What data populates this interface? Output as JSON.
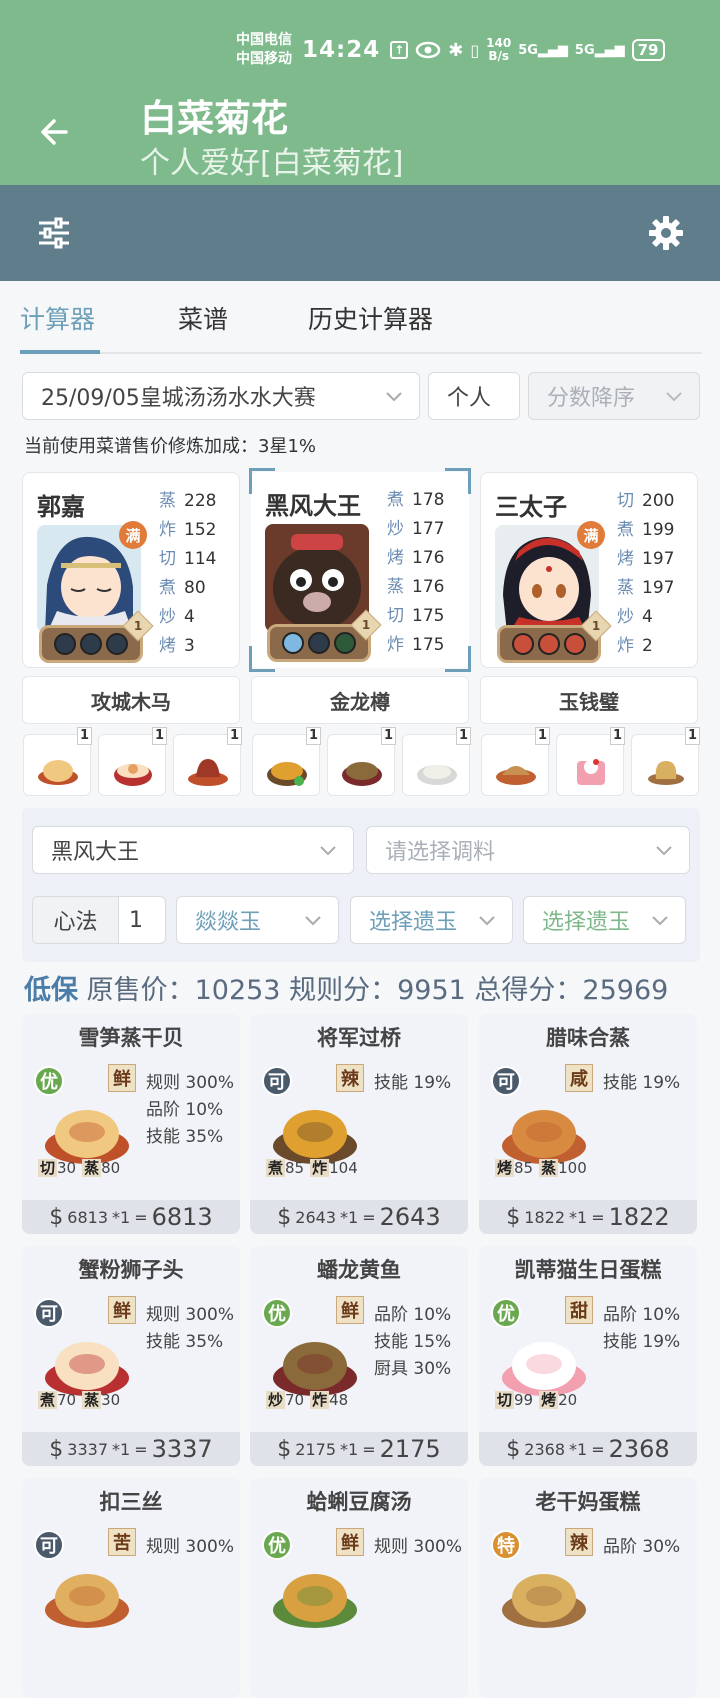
{
  "status": {
    "carrier1": "中国电信",
    "carrier2": "中国移动",
    "time": "14:24",
    "speed_top": "140",
    "speed_bot": "B/s",
    "sig1": "5G",
    "sig2": "5G",
    "battery": "79"
  },
  "header": {
    "title": "白菜菊花",
    "subtitle": "个人爱好[白菜菊花]"
  },
  "tabs": [
    "计算器",
    "菜谱",
    "历史计算器"
  ],
  "filters": {
    "contest": "25/09/05皇城汤汤水水大赛",
    "mode": "个人",
    "sort": "分数降序"
  },
  "note": "当前使用菜谱售价修炼加成：3星1%",
  "chefs": [
    {
      "name": "郭嘉",
      "badge": "满",
      "level": "1",
      "skills": [
        [
          "蒸",
          "228"
        ],
        [
          "炸",
          "152"
        ],
        [
          "切",
          "114"
        ],
        [
          "煮",
          "80"
        ],
        [
          "炒",
          "4"
        ],
        [
          "烤",
          "3"
        ]
      ]
    },
    {
      "name": "黑风大王",
      "level": "1",
      "skills": [
        [
          "煮",
          "178"
        ],
        [
          "炒",
          "177"
        ],
        [
          "烤",
          "176"
        ],
        [
          "蒸",
          "176"
        ],
        [
          "切",
          "175"
        ],
        [
          "炸",
          "175"
        ]
      ]
    },
    {
      "name": "三太子",
      "badge": "满",
      "level": "1",
      "skills": [
        [
          "切",
          "200"
        ],
        [
          "煮",
          "199"
        ],
        [
          "烤",
          "197"
        ],
        [
          "蒸",
          "197"
        ],
        [
          "炒",
          "4"
        ],
        [
          "炸",
          "2"
        ]
      ]
    }
  ],
  "equips": [
    "攻城木马",
    "金龙樽",
    "玉钱璧"
  ],
  "recipe_counts": [
    "1",
    "1",
    "1",
    "1",
    "1",
    "1",
    "1",
    "1",
    "1"
  ],
  "panel": {
    "chef": "黑风大王",
    "seasoning": "请选择调料",
    "xinfa_label": "心法",
    "xinfa_value": "1",
    "jade1": "燚燚玉",
    "jade2": "选择遗玉",
    "jade3": "选择遗玉"
  },
  "score": {
    "tag": "低保",
    "orig_label": "原售价：",
    "orig": "10253",
    "rule_label": "规则分：",
    "rule": "9951",
    "total_label": "总得分：",
    "total": "25969"
  },
  "cards": [
    {
      "name": "雪笋蒸干贝",
      "grade": "优",
      "flavor": "鲜",
      "fx": [
        "规则 300%",
        "品阶 10%",
        "技能 35%"
      ],
      "sk": [
        [
          "切",
          "30"
        ],
        [
          "蒸",
          "80"
        ]
      ],
      "price": "6813",
      "mult": "*1",
      "total": "6813"
    },
    {
      "name": "将军过桥",
      "grade": "可",
      "flavor": "辣",
      "fx": [
        "技能 19%"
      ],
      "sk": [
        [
          "煮",
          "85"
        ],
        [
          "炸",
          "104"
        ]
      ],
      "price": "2643",
      "mult": "*1",
      "total": "2643"
    },
    {
      "name": "腊味合蒸",
      "grade": "可",
      "flavor": "咸",
      "fx": [
        "技能 19%"
      ],
      "sk": [
        [
          "烤",
          "85"
        ],
        [
          "蒸",
          "100"
        ]
      ],
      "price": "1822",
      "mult": "*1",
      "total": "1822"
    },
    {
      "name": "蟹粉狮子头",
      "grade": "可",
      "flavor": "鲜",
      "fx": [
        "规则 300%",
        "技能 35%"
      ],
      "sk": [
        [
          "煮",
          "70"
        ],
        [
          "蒸",
          "30"
        ]
      ],
      "price": "3337",
      "mult": "*1",
      "total": "3337"
    },
    {
      "name": "蟠龙黄鱼",
      "grade": "优",
      "flavor": "鲜",
      "fx": [
        "品阶 10%",
        "技能 15%",
        "厨具 30%"
      ],
      "sk": [
        [
          "炒",
          "70"
        ],
        [
          "炸",
          "48"
        ]
      ],
      "price": "2175",
      "mult": "*1",
      "total": "2175"
    },
    {
      "name": "凯蒂猫生日蛋糕",
      "grade": "优",
      "flavor": "甜",
      "fx": [
        "品阶 10%",
        "技能 19%"
      ],
      "sk": [
        [
          "切",
          "99"
        ],
        [
          "烤",
          "20"
        ]
      ],
      "price": "2368",
      "mult": "*1",
      "total": "2368"
    },
    {
      "name": "扣三丝",
      "grade": "可",
      "flavor": "苦",
      "fx": [
        "规则 300%"
      ],
      "sk": [],
      "price": "",
      "mult": "",
      "total": ""
    },
    {
      "name": "蛤蜊豆腐汤",
      "grade": "优",
      "flavor": "鲜",
      "fx": [
        "规则 300%"
      ],
      "sk": [],
      "price": "",
      "mult": "",
      "total": ""
    },
    {
      "name": "老干妈蛋糕",
      "grade": "特",
      "flavor": "辣",
      "fx": [
        "品阶 30%"
      ],
      "sk": [],
      "price": "",
      "mult": "",
      "total": ""
    }
  ],
  "colors": {
    "header": "#7fba8d",
    "toolbar": "#607d8b",
    "accent": "#6e9fb8",
    "grade_you": "#6aa84f",
    "grade_ke": "#4a5a6a"
  }
}
